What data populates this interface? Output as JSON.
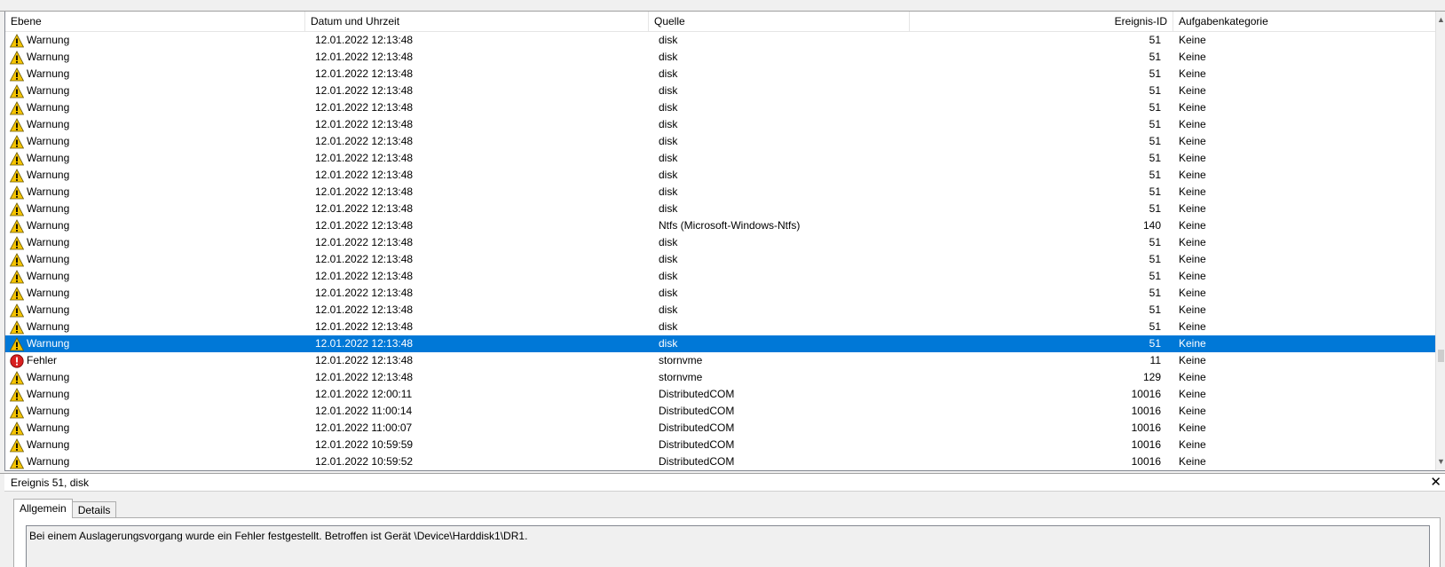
{
  "columns": {
    "level": "Ebene",
    "date": "Datum und Uhrzeit",
    "source": "Quelle",
    "event_id": "Ereignis-ID",
    "category": "Aufgabenkategorie"
  },
  "colors": {
    "selection": "#0078d7",
    "warning_icon": "#f5c400",
    "error_icon": "#d82020"
  },
  "events": [
    {
      "type": "warning",
      "level": "Warnung",
      "date": "12.01.2022 12:13:48",
      "source": "disk",
      "id": "51",
      "category": "Keine",
      "selected": false
    },
    {
      "type": "warning",
      "level": "Warnung",
      "date": "12.01.2022 12:13:48",
      "source": "disk",
      "id": "51",
      "category": "Keine",
      "selected": false
    },
    {
      "type": "warning",
      "level": "Warnung",
      "date": "12.01.2022 12:13:48",
      "source": "disk",
      "id": "51",
      "category": "Keine",
      "selected": false
    },
    {
      "type": "warning",
      "level": "Warnung",
      "date": "12.01.2022 12:13:48",
      "source": "disk",
      "id": "51",
      "category": "Keine",
      "selected": false
    },
    {
      "type": "warning",
      "level": "Warnung",
      "date": "12.01.2022 12:13:48",
      "source": "disk",
      "id": "51",
      "category": "Keine",
      "selected": false
    },
    {
      "type": "warning",
      "level": "Warnung",
      "date": "12.01.2022 12:13:48",
      "source": "disk",
      "id": "51",
      "category": "Keine",
      "selected": false
    },
    {
      "type": "warning",
      "level": "Warnung",
      "date": "12.01.2022 12:13:48",
      "source": "disk",
      "id": "51",
      "category": "Keine",
      "selected": false
    },
    {
      "type": "warning",
      "level": "Warnung",
      "date": "12.01.2022 12:13:48",
      "source": "disk",
      "id": "51",
      "category": "Keine",
      "selected": false
    },
    {
      "type": "warning",
      "level": "Warnung",
      "date": "12.01.2022 12:13:48",
      "source": "disk",
      "id": "51",
      "category": "Keine",
      "selected": false
    },
    {
      "type": "warning",
      "level": "Warnung",
      "date": "12.01.2022 12:13:48",
      "source": "disk",
      "id": "51",
      "category": "Keine",
      "selected": false
    },
    {
      "type": "warning",
      "level": "Warnung",
      "date": "12.01.2022 12:13:48",
      "source": "disk",
      "id": "51",
      "category": "Keine",
      "selected": false
    },
    {
      "type": "warning",
      "level": "Warnung",
      "date": "12.01.2022 12:13:48",
      "source": "Ntfs (Microsoft-Windows-Ntfs)",
      "id": "140",
      "category": "Keine",
      "selected": false
    },
    {
      "type": "warning",
      "level": "Warnung",
      "date": "12.01.2022 12:13:48",
      "source": "disk",
      "id": "51",
      "category": "Keine",
      "selected": false
    },
    {
      "type": "warning",
      "level": "Warnung",
      "date": "12.01.2022 12:13:48",
      "source": "disk",
      "id": "51",
      "category": "Keine",
      "selected": false
    },
    {
      "type": "warning",
      "level": "Warnung",
      "date": "12.01.2022 12:13:48",
      "source": "disk",
      "id": "51",
      "category": "Keine",
      "selected": false
    },
    {
      "type": "warning",
      "level": "Warnung",
      "date": "12.01.2022 12:13:48",
      "source": "disk",
      "id": "51",
      "category": "Keine",
      "selected": false
    },
    {
      "type": "warning",
      "level": "Warnung",
      "date": "12.01.2022 12:13:48",
      "source": "disk",
      "id": "51",
      "category": "Keine",
      "selected": false
    },
    {
      "type": "warning",
      "level": "Warnung",
      "date": "12.01.2022 12:13:48",
      "source": "disk",
      "id": "51",
      "category": "Keine",
      "selected": false
    },
    {
      "type": "warning",
      "level": "Warnung",
      "date": "12.01.2022 12:13:48",
      "source": "disk",
      "id": "51",
      "category": "Keine",
      "selected": true
    },
    {
      "type": "error",
      "level": "Fehler",
      "date": "12.01.2022 12:13:48",
      "source": "stornvme",
      "id": "11",
      "category": "Keine",
      "selected": false
    },
    {
      "type": "warning",
      "level": "Warnung",
      "date": "12.01.2022 12:13:48",
      "source": "stornvme",
      "id": "129",
      "category": "Keine",
      "selected": false
    },
    {
      "type": "warning",
      "level": "Warnung",
      "date": "12.01.2022 12:00:11",
      "source": "DistributedCOM",
      "id": "10016",
      "category": "Keine",
      "selected": false
    },
    {
      "type": "warning",
      "level": "Warnung",
      "date": "12.01.2022 11:00:14",
      "source": "DistributedCOM",
      "id": "10016",
      "category": "Keine",
      "selected": false
    },
    {
      "type": "warning",
      "level": "Warnung",
      "date": "12.01.2022 11:00:07",
      "source": "DistributedCOM",
      "id": "10016",
      "category": "Keine",
      "selected": false
    },
    {
      "type": "warning",
      "level": "Warnung",
      "date": "12.01.2022 10:59:59",
      "source": "DistributedCOM",
      "id": "10016",
      "category": "Keine",
      "selected": false
    },
    {
      "type": "warning",
      "level": "Warnung",
      "date": "12.01.2022 10:59:52",
      "source": "DistributedCOM",
      "id": "10016",
      "category": "Keine",
      "selected": false
    }
  ],
  "detail": {
    "title": "Ereignis 51, disk",
    "close": "✕",
    "tabs": [
      "Allgemein",
      "Details"
    ],
    "description": "Bei einem Auslagerungsvorgang wurde ein Fehler festgestellt. Betroffen ist Gerät \\Device\\Harddisk1\\DR1."
  },
  "scrollbar": {
    "up": "▲",
    "down": "▼"
  }
}
